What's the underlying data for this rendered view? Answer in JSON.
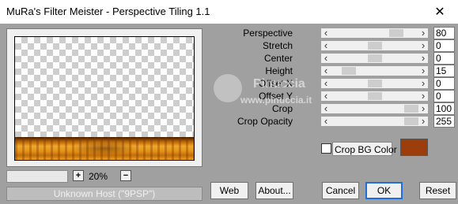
{
  "window": {
    "title": "MuRa's Filter Meister - Perspective Tiling 1.1"
  },
  "zoom": {
    "plus": "+",
    "value": "20%",
    "minus": "−"
  },
  "status": {
    "text": "Unknown Host (\"9PSP\")"
  },
  "sliders": [
    {
      "id": "perspective",
      "label": "Perspective",
      "value": "80",
      "level": 0.8
    },
    {
      "id": "stretch",
      "label": "Stretch",
      "value": "0",
      "level": 0.5
    },
    {
      "id": "center",
      "label": "Center",
      "value": "0",
      "level": 0.5
    },
    {
      "id": "height",
      "label": "Height",
      "value": "15",
      "level": 0.15
    },
    {
      "id": "offset-x",
      "label": "Offset X",
      "value": "0",
      "level": 0.5
    },
    {
      "id": "offset-y",
      "label": "Offset Y",
      "value": "0",
      "level": 0.5
    },
    {
      "id": "crop",
      "label": "Crop",
      "value": "100",
      "level": 1.0
    },
    {
      "id": "crop-opacity",
      "label": "Crop Opacity",
      "value": "255",
      "level": 1.0
    }
  ],
  "crop_bg": {
    "label": "Crop BG Color",
    "checked": false,
    "color": "#9b3e0c"
  },
  "buttons": {
    "web": "Web",
    "about": "About...",
    "cancel": "Cancel",
    "ok": "OK",
    "reset": "Reset"
  },
  "watermark": {
    "line1": "Pinuccia",
    "line2": "www.pinuccia.it"
  },
  "colors": {
    "window_bg": "#a0a0a0",
    "accent": "#1f6fd6"
  }
}
